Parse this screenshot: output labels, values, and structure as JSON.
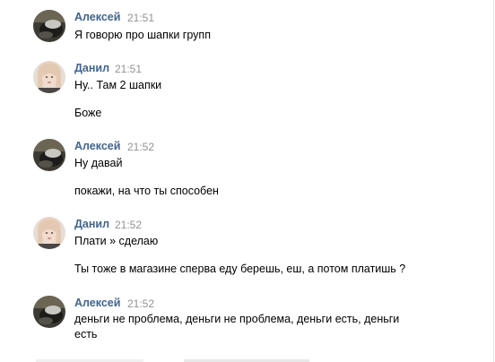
{
  "messages": [
    {
      "author": "Алексей",
      "time": "21:51",
      "avatar": "dark-cap-photo",
      "lines": [
        "Я говорю про шапки групп"
      ]
    },
    {
      "author": "Данил",
      "time": "21:51",
      "avatar": "light-hair-portrait",
      "lines": [
        "Ну.. Там 2 шапки",
        "Боже"
      ]
    },
    {
      "author": "Алексей",
      "time": "21:52",
      "avatar": "dark-cap-photo",
      "lines": [
        "Ну давай",
        "покажи, на что ты способен"
      ]
    },
    {
      "author": "Данил",
      "time": "21:52",
      "avatar": "light-hair-portrait",
      "lines": [
        "Плати » сделаю",
        "Ты тоже в магазине сперва еду берешь, еш, а потом платишь ?"
      ]
    },
    {
      "author": "Алексей",
      "time": "21:52",
      "avatar": "dark-cap-photo",
      "lines": [
        "деньги не проблема, деньги не проблема, деньги есть, деньги есть"
      ]
    }
  ],
  "colors": {
    "author_name": "#42648b",
    "timestamp": "#939393",
    "message_text": "#000000"
  }
}
